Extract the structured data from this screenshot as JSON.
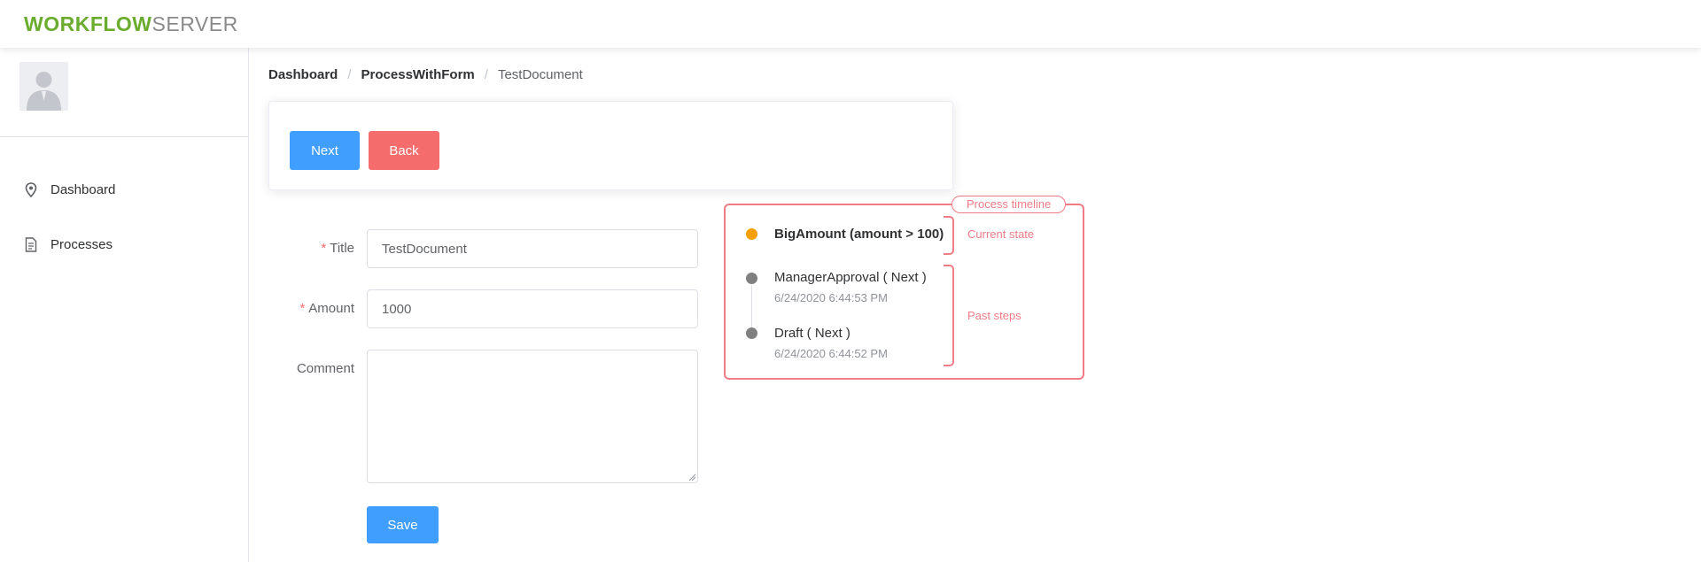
{
  "header": {
    "logo_bold": "WORKFLOW",
    "logo_light": "SERVER"
  },
  "sidebar": {
    "avatar": "user-avatar",
    "items": [
      {
        "label": "Dashboard",
        "icon": "location-pin-icon"
      },
      {
        "label": "Processes",
        "icon": "document-icon"
      }
    ]
  },
  "breadcrumb": {
    "items": [
      "Dashboard",
      "ProcessWithForm",
      "TestDocument"
    ],
    "separator": "/"
  },
  "commands": {
    "next_label": "Next",
    "back_label": "Back"
  },
  "form": {
    "required_mark": "*",
    "title": {
      "label": "Title",
      "value": "TestDocument"
    },
    "amount": {
      "label": "Amount",
      "value": "1000"
    },
    "comment": {
      "label": "Comment",
      "value": ""
    },
    "save_label": "Save"
  },
  "timeline": {
    "tag": "Process timeline",
    "current": {
      "title": "BigAmount (amount > 100)",
      "color": "#f5a000"
    },
    "past": [
      {
        "title": "ManagerApproval ( Next )",
        "date": "6/24/2020 6:44:53 PM"
      },
      {
        "title": "Draft ( Next )",
        "date": "6/24/2020 6:44:52 PM"
      }
    ],
    "past_color": "#808080",
    "current_annotation": "Current state",
    "past_annotation": "Past steps",
    "annotation_color": "#f07c86"
  },
  "colors": {
    "primary": "#409eff",
    "danger": "#f56c6c",
    "logo_green": "#6aac2e"
  }
}
